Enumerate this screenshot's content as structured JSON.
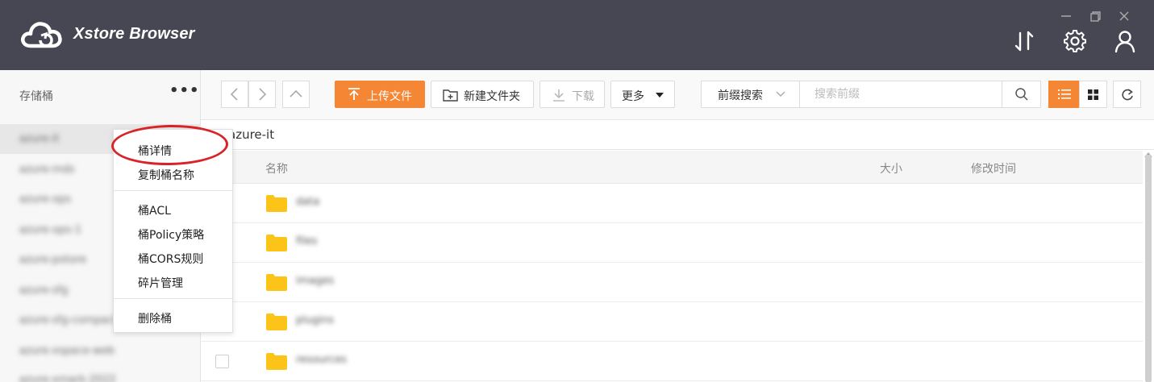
{
  "app": {
    "title": "Xstore Browser"
  },
  "window_controls": [
    "minimize-icon",
    "restore-icon",
    "close-icon"
  ],
  "header_icons": [
    "transfer-icon",
    "gear-icon",
    "user-icon"
  ],
  "sidebar": {
    "title": "存储桶",
    "more": "•••",
    "buckets": [
      {
        "name": "azure-it",
        "selected": true
      },
      {
        "name": "azure-mds"
      },
      {
        "name": "azure-ops"
      },
      {
        "name": "azure-ops-1"
      },
      {
        "name": "azure-potore"
      },
      {
        "name": "azure-sfg"
      },
      {
        "name": "azure-sfg-compact"
      },
      {
        "name": "azure-xspace-web"
      },
      {
        "name": "azure-xmark-2022"
      }
    ]
  },
  "context_menu": {
    "items": [
      "桶详情",
      "复制桶名称",
      "桶ACL",
      "桶Policy策略",
      "桶CORS规则",
      "碎片管理",
      "删除桶"
    ],
    "highlighted": "桶详情"
  },
  "toolbar": {
    "upload": "上传文件",
    "new_folder": "新建文件夹",
    "download": "下载",
    "more": "更多",
    "prefix_search": "前缀搜索",
    "search_placeholder": "搜索前缀",
    "view_mode": "list"
  },
  "breadcrumb": {
    "path": "azure-it"
  },
  "file_table": {
    "columns": {
      "name": "名称",
      "size": "大小",
      "modified": "修改时间"
    },
    "rows": [
      {
        "name": "data",
        "type": "folder"
      },
      {
        "name": "files",
        "type": "folder"
      },
      {
        "name": "images",
        "type": "folder"
      },
      {
        "name": "plugins",
        "type": "folder"
      },
      {
        "name": "resources",
        "type": "folder"
      }
    ]
  },
  "colors": {
    "titlebar": "#464753",
    "accent": "#f58634",
    "folder": "#fcc419",
    "highlight_ring": "#d92328"
  }
}
